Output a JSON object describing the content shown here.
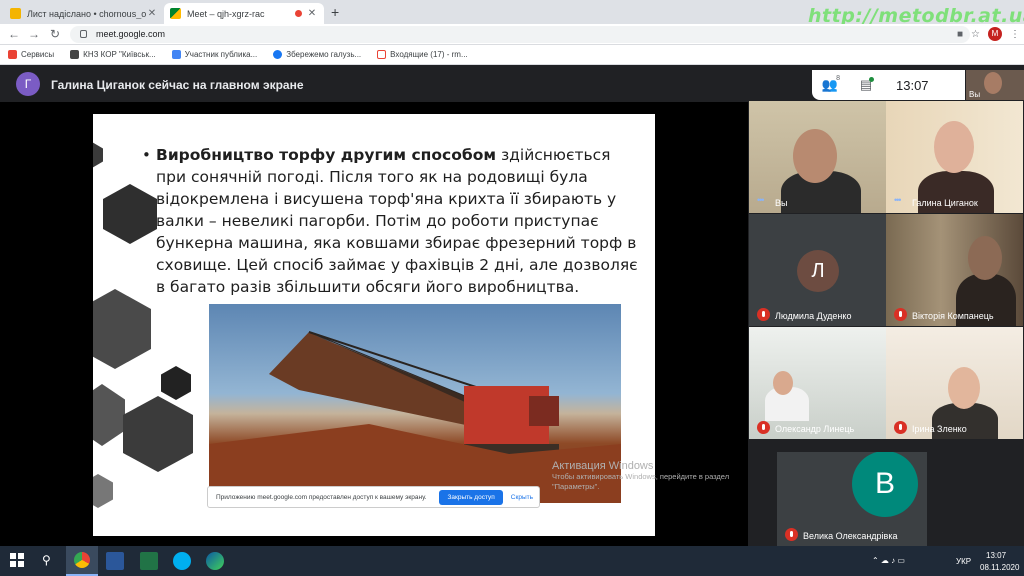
{
  "browser": {
    "tabs": [
      {
        "title": "Лист надіслано • chornous_o_v@",
        "icon": "mail-icon"
      },
      {
        "title": "Meet – qjh-xgrz-rac",
        "icon": "meet-icon"
      }
    ],
    "new_tab": "+",
    "url": "meet.google.com",
    "profile_initial": "M",
    "bookmarks": [
      "Сервисы",
      "КНЗ КОР \"Київськ...",
      "Участник публика...",
      "Збережемо галузь...",
      "Входящие (17) - rm..."
    ]
  },
  "watermark": "http://metodbr.at.ua/",
  "meet": {
    "presenter_initial": "Г",
    "presenter_text": "Галина Циганок сейчас на главном экране",
    "people_count": "8",
    "time": "13:07",
    "self_label": "Вы"
  },
  "slide": {
    "bullet": "•",
    "bold_text": "Виробництво торфу другим способом",
    "body_text": " здійснюється при сонячній погоді. Після того як на родовищі була відокремлена і висушена торф'яна крихта її збирають у валки – невеликі пагорби. Потім до роботи приступає бункерна машина, яка ковшами збирає фрезерний торф в сховище. Цей спосіб займає у фахівців 2 дні, але дозволяє в багато разів збільшити обсяги його виробництва."
  },
  "notification": {
    "text": "Приложению meet.google.com предоставлен доступ к вашему экрану.",
    "stop_button": "Закрыть доступ",
    "hide_link": "Скрыть"
  },
  "activation": {
    "title": "Активация Windows",
    "subtitle": "Чтобы активировать Windows, перейдите в раздел \"Параметры\"."
  },
  "participants": [
    {
      "name": "Вы",
      "muted": false,
      "speaking": true
    },
    {
      "name": "Галина Циганок",
      "muted": false,
      "speaking": true
    },
    {
      "name": "Людмила Дуденко",
      "muted": true,
      "initial": "Л"
    },
    {
      "name": "Вікторія Компанець",
      "muted": true
    },
    {
      "name": "Олександр Линець",
      "muted": true
    },
    {
      "name": "Ірина Зленко",
      "muted": true
    },
    {
      "name": "Велика Олександрівка",
      "muted": true,
      "initial": "В"
    }
  ],
  "taskbar": {
    "language": "УКР",
    "time": "13:07",
    "date": "08.11.2020"
  },
  "colors": {
    "meet_bg": "#202124",
    "avatar_l": "#6d4c41",
    "avatar_v": "#00897b",
    "presenter_avatar": "#7b5cc4",
    "accent": "#1a73e8",
    "mic_off": "#d93025"
  }
}
